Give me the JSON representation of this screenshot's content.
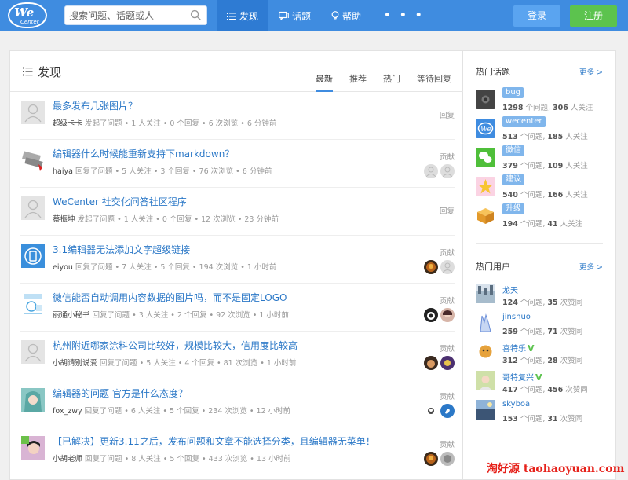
{
  "header": {
    "logo_text": "We",
    "logo_sub": "Center",
    "search_placeholder": "搜索问题、话题或人",
    "nav": [
      {
        "label": "发现",
        "icon": "list-icon"
      },
      {
        "label": "话题",
        "icon": "chat-icon"
      },
      {
        "label": "帮助",
        "icon": "lightbulb-icon"
      }
    ],
    "more": "• • •",
    "login": "登录",
    "signup": "注册"
  },
  "main": {
    "title": "发现",
    "tabs": [
      "最新",
      "推荐",
      "热门",
      "等待回复"
    ],
    "questions": [
      {
        "title": "最多发布几张图片？",
        "user": "超级卡卡",
        "action": "发起了问题",
        "stats": " • 1 人关注 • 0 个回复 • 6 次浏览 • 6 分钟前",
        "label": "回复"
      },
      {
        "title": "编辑器什么时候能重新支持下markdown？",
        "user": "haiya",
        "action": "回复了问题",
        "stats": " • 5 人关注 • 3 个回复 • 76 次浏览 • 6 分钟前",
        "label": "贡献"
      },
      {
        "title": "WeCenter 社交化问答社区程序",
        "user": "蔡振坤",
        "action": "发起了问题",
        "stats": " • 1 人关注 • 0 个回复 • 12 次浏览 • 23 分钟前",
        "label": "回复"
      },
      {
        "title": "3.1编辑器无法添加文字超级链接",
        "user": "eiyou",
        "action": "回复了问题",
        "stats": " • 7 人关注 • 5 个回复 • 194 次浏览 • 1 小时前",
        "label": "贡献"
      },
      {
        "title": "微信能否自动调用内容数据的图片吗，而不是固定LOGO",
        "user": "丽通小秘书",
        "action": "回复了问题",
        "stats": " • 3 人关注 • 2 个回复 • 92 次浏览 • 1 小时前",
        "label": "贡献"
      },
      {
        "title": "杭州附近哪家涂料公司比较好，规模比较大，信用度比较高",
        "user": "小胡请别说爱",
        "action": "回复了问题",
        "stats": " • 5 人关注 • 4 个回复 • 81 次浏览 • 1 小时前",
        "label": "贡献"
      },
      {
        "title": "编辑器的问题 官方是什么态度？",
        "user": "fox_zwy",
        "action": "回复了问题",
        "stats": " • 6 人关注 • 5 个回复 • 234 次浏览 • 12 小时前",
        "label": "贡献"
      },
      {
        "title": "【已解决】更新3.11之后，发布问题和文章不能选择分类，且编辑器无菜单！",
        "user": "小胡老师",
        "action": "回复了问题",
        "stats": " • 8 人关注 • 5 个回复 • 433 次浏览 • 13 小时前",
        "label": "贡献"
      }
    ]
  },
  "sidebar": {
    "hot_topics_title": "热门话题",
    "more_label": "更多 >",
    "topics": [
      {
        "tag": "bug",
        "questions": "1298",
        "followers": "306"
      },
      {
        "tag": "wecenter",
        "questions": "513",
        "followers": "185"
      },
      {
        "tag": "微信",
        "questions": "379",
        "followers": "109"
      },
      {
        "tag": "建议",
        "questions": "540",
        "followers": "166"
      },
      {
        "tag": "升级",
        "questions": "194",
        "followers": "41"
      }
    ],
    "topic_q_unit": " 个问题, ",
    "topic_f_unit": " 人关注",
    "hot_users_title": "热门用户",
    "users": [
      {
        "name": "龙天",
        "questions": "124",
        "likes": "35"
      },
      {
        "name": "jinshuo",
        "questions": "259",
        "likes": "71"
      },
      {
        "name": "喜特乐",
        "questions": "312",
        "likes": "28",
        "verified": "V"
      },
      {
        "name": "哥特复兴",
        "questions": "417",
        "likes": "456",
        "verified": "V"
      },
      {
        "name": "skyboa",
        "questions": "153",
        "likes": "31"
      }
    ],
    "user_q_unit": " 个问题, ",
    "user_l_unit": " 次赞同"
  },
  "watermark": "淘好源 taohaoyuan.com",
  "colors": {
    "brand": "#3f8ce0",
    "link": "#2b78c7",
    "signup": "#5cc34e"
  }
}
